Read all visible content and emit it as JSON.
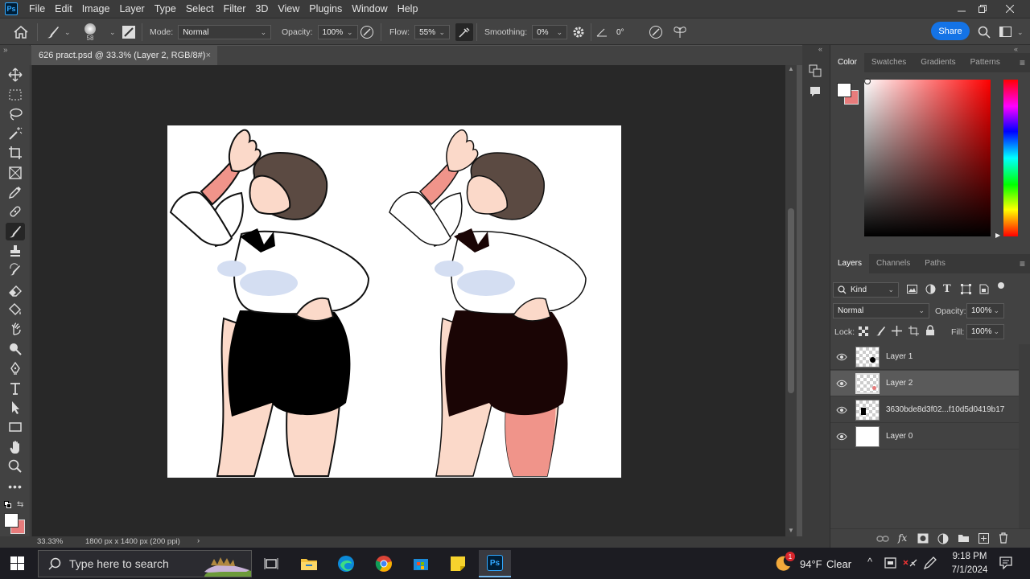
{
  "app": {
    "logo": "Ps"
  },
  "menu": [
    "File",
    "Edit",
    "Image",
    "Layer",
    "Type",
    "Select",
    "Filter",
    "3D",
    "View",
    "Plugins",
    "Window",
    "Help"
  ],
  "options": {
    "brush_size": "58",
    "mode_label": "Mode:",
    "mode_value": "Normal",
    "opacity_label": "Opacity:",
    "opacity_value": "100%",
    "flow_label": "Flow:",
    "flow_value": "55%",
    "smoothing_label": "Smoothing:",
    "smoothing_value": "0%",
    "angle_value": "0°",
    "share_label": "Share"
  },
  "document": {
    "tab_title": "626 pract.psd @ 33.3% (Layer 2, RGB/8#)",
    "close_glyph": "×",
    "zoom": "33.33%",
    "dimensions": "1800 px x 1400 px (200 ppi)"
  },
  "color_panel": {
    "tabs": [
      "Color",
      "Swatches",
      "Gradients",
      "Patterns"
    ],
    "foreground": "#ffffff",
    "background": "#e87c7c"
  },
  "layers_panel": {
    "tabs": [
      "Layers",
      "Channels",
      "Paths"
    ],
    "filter_kind": "Kind",
    "blend_mode": "Normal",
    "opacity_label": "Opacity:",
    "opacity_value": "100%",
    "lock_label": "Lock:",
    "fill_label": "Fill:",
    "fill_value": "100%",
    "layers": [
      {
        "name": "Layer 1",
        "selected": false
      },
      {
        "name": "Layer 2",
        "selected": true
      },
      {
        "name": "3630bde8d3f02...f10d5d0419b17",
        "selected": false
      },
      {
        "name": "Layer 0",
        "selected": false
      }
    ]
  },
  "taskbar": {
    "search_placeholder": "Type here to search",
    "weather_temp": "94°F",
    "weather_desc": "Clear",
    "weather_badge": "1",
    "time": "9:18 PM",
    "date": "7/1/2024"
  },
  "colors": {
    "accent": "#1473e6",
    "skirt_left": "#000000",
    "skirt_right": "#1a0505",
    "skin_left": "#fbd9c9",
    "skin_right": "#f0948a"
  }
}
